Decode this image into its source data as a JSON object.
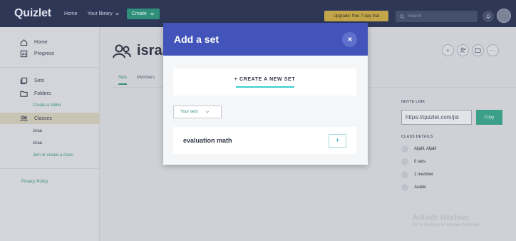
{
  "colors": {
    "topbar": "#2e3856",
    "accent_teal": "#3a8f81",
    "modal_header": "#4254b9",
    "upgrade": "#c4a64a",
    "create_button": "#2f8f7a"
  },
  "topbar": {
    "brand": "Quizlet",
    "home": "Home",
    "library": "Your library",
    "create": "Create",
    "upgrade": "Upgrade: free 7-day trial",
    "search_placeholder": "Search",
    "icons": [
      "chevron-down-icon",
      "search-icon",
      "bell-icon"
    ]
  },
  "sidebar": {
    "home": "Home",
    "progress": "Progress",
    "sets": "Sets",
    "folders": "Folders",
    "create_folder": "Create a folder",
    "classes": "Classes",
    "class_items": [
      "israa",
      "israa"
    ],
    "join_class": "Join or create a class",
    "privacy": "Privacy Policy"
  },
  "main": {
    "title": "israa",
    "tabs": [
      "Sets",
      "Members"
    ],
    "active_tab": "Sets"
  },
  "right_panel": {
    "invite_label": "INVITE LINK",
    "invite_url": "https://quizlet.com/joi",
    "copy": "Copy",
    "details_label": "CLASS DETAILS",
    "details": [
      "Aljalil, Aljalil",
      "0 sets",
      "1 member",
      "Arabic"
    ]
  },
  "watermark": {
    "title": "Activate Windows",
    "subtitle": "Go to Settings to activate Windows."
  },
  "modal": {
    "title": "Add a set",
    "create_new": "+ CREATE A NEW SET",
    "dropdown_selected": "Your sets",
    "sets": [
      {
        "name": "evaluation math"
      }
    ]
  }
}
